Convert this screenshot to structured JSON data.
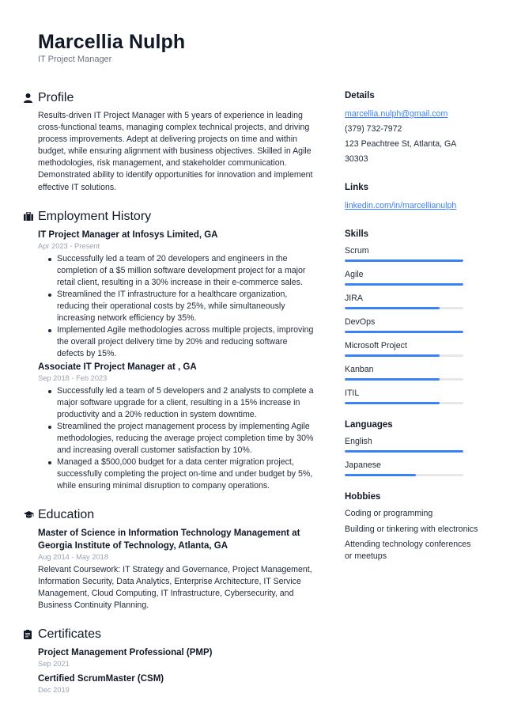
{
  "header": {
    "name": "Marcellia Nulph",
    "title": "IT Project Manager"
  },
  "profile": {
    "heading": "Profile",
    "icon": "person-icon",
    "text": "Results-driven IT Project Manager with 5 years of experience in leading cross-functional teams, managing complex technical projects, and driving process improvements. Adept at delivering projects on time and within budget, while ensuring alignment with business objectives. Skilled in Agile methodologies, risk management, and stakeholder communication. Demonstrated ability to identify opportunities for innovation and implement effective IT solutions."
  },
  "employment": {
    "heading": "Employment History",
    "icon": "briefcase-icon",
    "jobs": [
      {
        "title": "IT Project Manager at Infosys Limited, GA",
        "dates": "Apr 2023 - Present",
        "bullets": [
          "Successfully led a team of 20 developers and engineers in the completion of a $5 million software development project for a major retail client, resulting in a 30% increase in their e-commerce sales.",
          "Streamlined the IT infrastructure for a healthcare organization, reducing their operational costs by 25%, while simultaneously increasing network efficiency by 35%.",
          "Implemented Agile methodologies across multiple projects, improving the overall project delivery time by 20% and reducing software defects by 15%."
        ]
      },
      {
        "title": "Associate IT Project Manager at , GA",
        "dates": "Sep 2018 - Feb 2023",
        "bullets": [
          "Successfully led a team of 5 developers and 2 analysts to complete a major software upgrade for a client, resulting in a 15% increase in productivity and a 20% reduction in system downtime.",
          "Streamlined the project management process by implementing Agile methodologies, reducing the average project completion time by 30% and increasing overall customer satisfaction by 10%.",
          "Managed a $500,000 budget for a data center migration project, successfully completing the project on-time and under budget by 5%, while ensuring minimal disruption to company operations."
        ]
      }
    ]
  },
  "education": {
    "heading": "Education",
    "icon": "graduation-cap-icon",
    "degree": "Master of Science in Information Technology Management at Georgia Institute of Technology, Atlanta, GA",
    "dates": "Aug 2014 - May 2018",
    "text": "Relevant Coursework: IT Strategy and Governance, Project Management, Information Security, Data Analytics, Enterprise Architecture, IT Service Management, Cloud Computing, IT Infrastructure, Cybersecurity, and Business Continuity Planning."
  },
  "certificates": {
    "heading": "Certificates",
    "icon": "certificate-icon",
    "items": [
      {
        "name": "Project Management Professional (PMP)",
        "date": "Sep 2021"
      },
      {
        "name": "Certified ScrumMaster (CSM)",
        "date": "Dec 2019"
      }
    ]
  },
  "details": {
    "heading": "Details",
    "email": "marcellia.nulph@gmail.com",
    "phone": "(379) 732-7972",
    "address": "123 Peachtree St, Atlanta, GA 30303"
  },
  "links": {
    "heading": "Links",
    "linkedin": "linkedin.com/in/marcellianulph"
  },
  "skills": {
    "heading": "Skills",
    "items": [
      {
        "name": "Scrum",
        "level": 1.0
      },
      {
        "name": "Agile",
        "level": 1.0
      },
      {
        "name": "JIRA",
        "level": 0.8
      },
      {
        "name": "DevOps",
        "level": 1.0
      },
      {
        "name": "Microsoft Project",
        "level": 0.8
      },
      {
        "name": "Kanban",
        "level": 0.8
      },
      {
        "name": "ITIL",
        "level": 0.8
      }
    ]
  },
  "languages": {
    "heading": "Languages",
    "items": [
      {
        "name": "English",
        "level": 1.0
      },
      {
        "name": "Japanese",
        "level": 0.6
      }
    ]
  },
  "hobbies": {
    "heading": "Hobbies",
    "items": [
      "Coding or programming",
      "Building or tinkering with electronics",
      "Attending technology conferences or meetups"
    ]
  },
  "colors": {
    "accent": "#3b82f6",
    "track": "#e5e7eb",
    "muted": "#9ca3af"
  }
}
